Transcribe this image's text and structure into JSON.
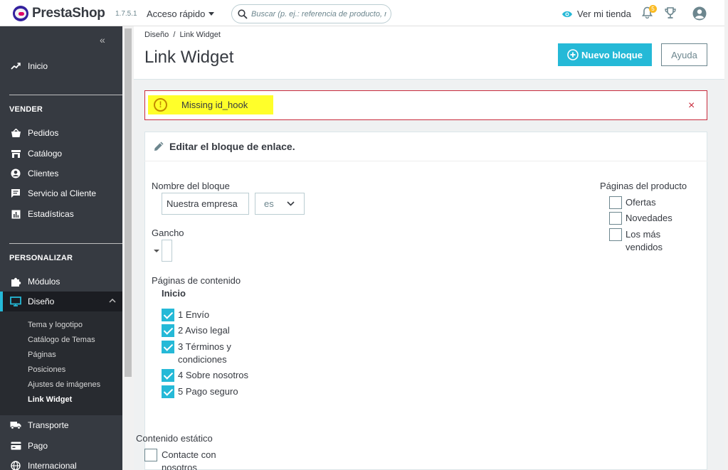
{
  "header": {
    "brand": "PrestaShop",
    "version": "1.7.5.1",
    "quick_access": "Acceso rápido",
    "search_placeholder": "Buscar (p. ej.: referencia de producto, nombre de cliente...)",
    "view_store": "Ver mi tienda",
    "notifications_count": "5"
  },
  "sidebar": {
    "home": "Inicio",
    "sell_heading": "VENDER",
    "sell_items": [
      "Pedidos",
      "Catálogo",
      "Clientes",
      "Servicio al Cliente",
      "Estadísticas"
    ],
    "customize_heading": "PERSONALIZAR",
    "modules": "Módulos",
    "design": "Diseño",
    "design_sub": [
      "Tema y logotipo",
      "Catálogo de Temas",
      "Páginas",
      "Posiciones",
      "Ajustes de imágenes",
      "Link Widget"
    ],
    "shipping": "Transporte",
    "payment": "Pago",
    "international": "Internacional"
  },
  "page": {
    "breadcrumb_parent": "Diseño",
    "breadcrumb_sep": "/",
    "breadcrumb_current": "Link Widget",
    "title": "Link Widget",
    "new_block_button": "Nuevo bloque",
    "help_button": "Ayuda"
  },
  "alert": {
    "message": "Missing id_hook",
    "close": "×"
  },
  "form": {
    "panel_title": "Editar el bloque de enlace.",
    "block_name_label": "Nombre del bloque",
    "block_name_value": "Nuestra empresa",
    "language": "es",
    "hook_label": "Gancho",
    "content_pages_label": "Páginas de contenido",
    "content_category": "Inicio",
    "content_pages": [
      {
        "label": "1 Envío",
        "checked": true
      },
      {
        "label": "2 Aviso legal",
        "checked": true
      },
      {
        "label": "3 Términos y condiciones",
        "checked": true
      },
      {
        "label": "4 Sobre nosotros",
        "checked": true
      },
      {
        "label": "5 Pago seguro",
        "checked": true
      }
    ],
    "product_pages_label": "Páginas del producto",
    "product_pages": [
      {
        "label": "Ofertas",
        "checked": false
      },
      {
        "label": "Novedades",
        "checked": false
      },
      {
        "label": "Los más vendidos",
        "checked": false
      }
    ],
    "static_content_label": "Contenido estático",
    "static_content": [
      {
        "label": "Contacte con nosotros",
        "checked": false
      }
    ]
  },
  "colors": {
    "accent": "#25b9d7",
    "sidebar": "#363a41",
    "alert_border": "#c82a3c",
    "highlight": "#ffff2a"
  }
}
